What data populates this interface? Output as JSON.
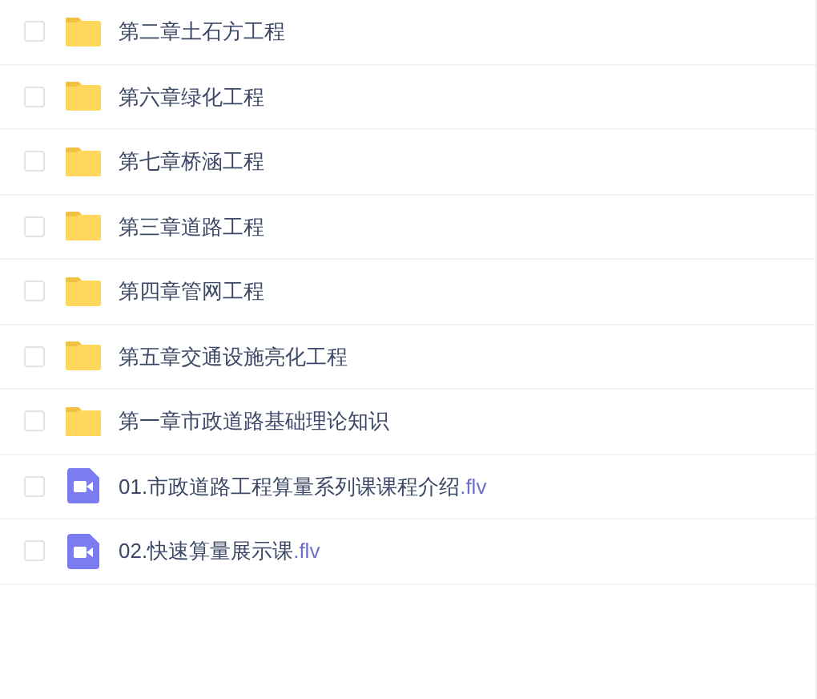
{
  "files": [
    {
      "kind": "folder",
      "name": "第二章土石方工程",
      "checked": false
    },
    {
      "kind": "folder",
      "name": "第六章绿化工程",
      "checked": false
    },
    {
      "kind": "folder",
      "name": "第七章桥涵工程",
      "checked": false
    },
    {
      "kind": "folder",
      "name": "第三章道路工程",
      "checked": false
    },
    {
      "kind": "folder",
      "name": "第四章管网工程",
      "checked": false
    },
    {
      "kind": "folder",
      "name": "第五章交通设施亮化工程",
      "checked": false
    },
    {
      "kind": "folder",
      "name": "第一章市政道路基础理论知识",
      "checked": false
    },
    {
      "kind": "video",
      "name": "01.市政道路工程算量系列课课程介绍",
      "ext": ".flv",
      "checked": false
    },
    {
      "kind": "video",
      "name": "02.快速算量展示课",
      "ext": ".flv",
      "checked": false
    }
  ]
}
